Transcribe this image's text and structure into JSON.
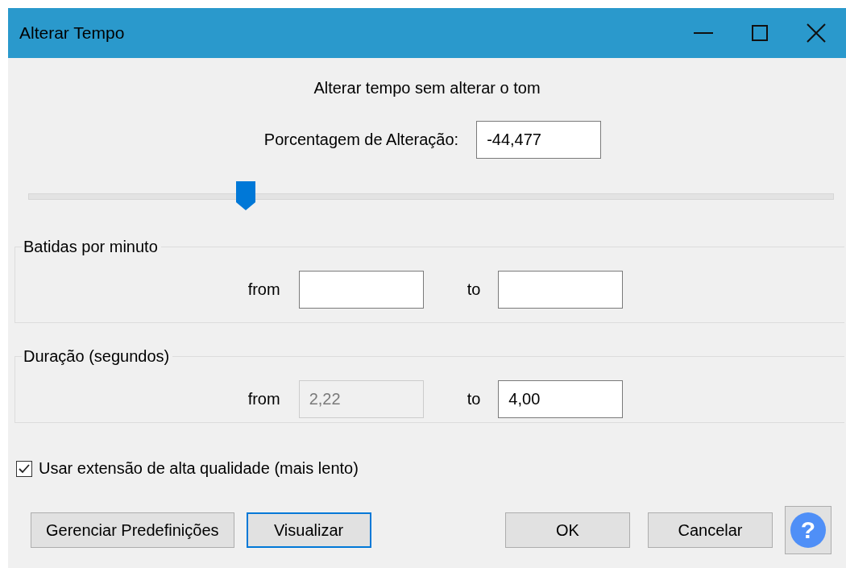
{
  "window": {
    "title": "Alterar Tempo"
  },
  "heading": "Alterar tempo sem alterar o tom",
  "percent": {
    "label": "Porcentagem de Alteração:",
    "value": "-44,477"
  },
  "slider": {
    "level": 0.27
  },
  "groups": [
    {
      "title": "Batidas por minuto",
      "fields": [
        {
          "label": "from",
          "disabled": false
        },
        {
          "label": "to",
          "disabled": false
        }
      ]
    },
    {
      "title": "Duração (segundos)",
      "fields": [
        {
          "label": "from",
          "value": "2,22",
          "disabled": true
        },
        {
          "label": "to",
          "value": "4,00",
          "disabled": false
        }
      ]
    }
  ],
  "checkbox": {
    "label": "Usar extensão de alta qualidade (mais lento)",
    "checked": true
  },
  "buttons": [
    {
      "kind": "text",
      "label": "Gerenciar Predefinições",
      "focused": false
    },
    {
      "kind": "text",
      "label": "Visualizar",
      "focused": true
    },
    {
      "kind": "spacer"
    },
    {
      "kind": "text",
      "label": "OK",
      "focused": false
    },
    {
      "kind": "text",
      "label": "Cancelar",
      "focused": false
    },
    {
      "kind": "help",
      "label": "?",
      "focused": false
    }
  ]
}
